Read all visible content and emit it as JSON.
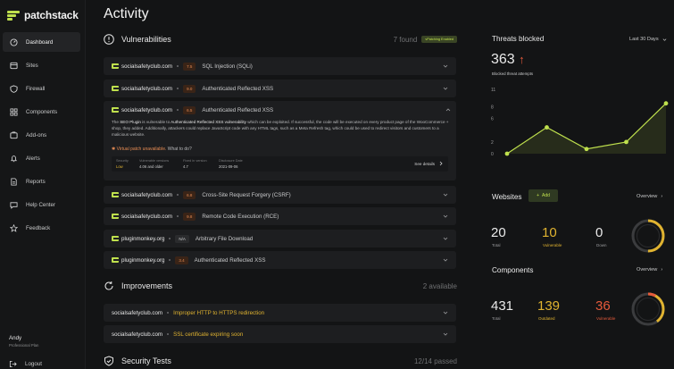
{
  "brand": {
    "name": "patchstack",
    "accent": "#bfe04d"
  },
  "sidebar": {
    "items": [
      {
        "label": "Dashboard",
        "icon": "dashboard-icon"
      },
      {
        "label": "Sites",
        "icon": "sites-icon"
      },
      {
        "label": "Firewall",
        "icon": "shield-icon"
      },
      {
        "label": "Components",
        "icon": "components-icon"
      },
      {
        "label": "Add-ons",
        "icon": "addons-icon"
      },
      {
        "label": "Alerts",
        "icon": "bell-icon"
      },
      {
        "label": "Reports",
        "icon": "reports-icon"
      },
      {
        "label": "Help Center",
        "icon": "help-icon"
      },
      {
        "label": "Feedback",
        "icon": "star-icon"
      }
    ],
    "user": {
      "name": "Andy",
      "plan": "Professional Plan"
    },
    "logout": "Logout"
  },
  "main": {
    "title": "Activity",
    "vulnerabilities": {
      "title": "Vulnerabilities",
      "count": "7 found",
      "badge": "vPatching Enabled",
      "rows": [
        {
          "site": "socialsafetyclub.com",
          "score": "7.5",
          "name": "SQL Injection (SQLi)"
        },
        {
          "site": "socialsafetyclub.com",
          "score": "9.0",
          "name": "Authenticated Reflected XSS"
        },
        {
          "site": "socialsafetyclub.com",
          "score": "6.5",
          "name": "Authenticated Reflected XSS"
        },
        {
          "site": "socialsafetyclub.com",
          "score": "6.8",
          "name": "Cross-Site Request Forgery (CSRF)"
        },
        {
          "site": "socialsafetyclub.com",
          "score": "9.8",
          "name": "Remote Code Execution (RCE)"
        },
        {
          "site": "pluginmonkey.org",
          "score": "N/A",
          "name": "Arbitrary File Download"
        },
        {
          "site": "pluginmonkey.org",
          "score": "3.4",
          "name": "Authenticated Reflected XSS"
        }
      ],
      "detail": {
        "t1": "The ",
        "plugin": "SEO Plugin",
        "t2": " is vulnerable to ",
        "vuln": "Authenticated Reflected XSS vulnerability",
        "t3": " which can be exploited. If successful, the code will be executed on every product page of the WooCommerce + shop, they added. Additionally, attackers could replace JavaScript code with any HTML tags, such as a Meta Refresh tag, which could be used to redirect visitors and customers to a malicious website.",
        "warn": "Virtual patch unavailable.",
        "warn_q": " What to do?",
        "security_label": "Security",
        "security_value": "Low",
        "versions_label": "Vulnerable versions",
        "versions_value": "4.06 and older",
        "fixed_label": "Fixed in version",
        "fixed_value": "4.7",
        "disclosure_label": "Disclosure Date",
        "disclosure_value": "2021-09-06",
        "see_details": "See details"
      }
    },
    "improvements": {
      "title": "Improvements",
      "count": "2 available",
      "rows": [
        {
          "site": "socialsafetyclub.com",
          "text": "Improper HTTP to HTTPS redirection"
        },
        {
          "site": "socialsafetyclub.com",
          "text": "SSL certificate expiring soon"
        }
      ]
    },
    "security_tests": {
      "title": "Security Tests",
      "count": "12/14 passed"
    }
  },
  "right": {
    "threats": {
      "title": "Threats blocked",
      "period": "Last 30 Days",
      "value": "363",
      "caption": "Blocked threat attempts",
      "y_ticks": [
        "11",
        "8",
        "6",
        "2",
        "0"
      ]
    },
    "websites": {
      "title": "Websites",
      "add": "Add",
      "overview": "Overview",
      "total": "20",
      "total_label": "Total",
      "vulnerable": "10",
      "vulnerable_label": "Vulnerable",
      "down": "0",
      "down_label": "Down",
      "ring_fraction": 0.5
    },
    "components": {
      "title": "Components",
      "overview": "Overview",
      "total": "431",
      "total_label": "Total",
      "outdated": "139",
      "outdated_label": "Outdated",
      "vulnerable": "36",
      "vulnerable_label": "Vulnerable",
      "ring_fraction_outdated": 0.32,
      "ring_fraction_vulnerable": 0.08
    }
  },
  "chart_data": {
    "type": "line",
    "x": [
      1,
      2,
      3,
      4,
      5
    ],
    "values": [
      0,
      4.5,
      0.8,
      2,
      8.6
    ],
    "ylim": [
      0,
      11
    ]
  },
  "colors": {
    "accent": "#bfe04d",
    "warning": "#e0b330",
    "danger": "#e55a3b",
    "orange": "#e58b53"
  }
}
